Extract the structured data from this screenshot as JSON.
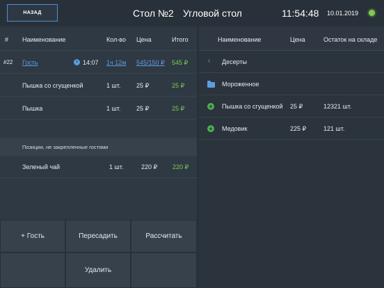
{
  "header": {
    "back_label": "НАЗАД",
    "table_number": "Стол №2",
    "table_name": "Угловой стол",
    "time": "11:54:48",
    "date": "10.01.2019",
    "status_color": "#7ecb52"
  },
  "order": {
    "columns": [
      "#",
      "Наименование",
      "Кол-во",
      "Цена",
      "Итого"
    ],
    "guest_row": {
      "number": "#22",
      "name": "Гость",
      "time": "14:07",
      "duration": "1ч 12м",
      "price": "545/150 ₽",
      "total": "545 ₽"
    },
    "items": [
      {
        "name": "Пышка со сгущенкой",
        "qty": "1 шт.",
        "price": "25 ₽",
        "total": "25 ₽"
      },
      {
        "name": "Пышка",
        "qty": "1 шт.",
        "price": "25 ₽",
        "total": "25 ₽"
      }
    ],
    "unassigned_label": "Позиции, не закрепленные гостями",
    "unassigned_items": [
      {
        "name": "Зеленый чай",
        "qty": "1 шт.",
        "price": "220 ₽",
        "total": "220 ₽"
      }
    ]
  },
  "actions": {
    "add_guest": "+ Гость",
    "move": "Пересадить",
    "checkout": "Рассчитать",
    "delete": "Удалить"
  },
  "menu": {
    "columns": [
      "Наименование",
      "Цена",
      "Остаток на складе"
    ],
    "back_category": "Десерты",
    "folder": "Мороженное",
    "items": [
      {
        "name": "Пышка со сгущенкой",
        "price": "25 ₽",
        "stock": "12321 шт."
      },
      {
        "name": "Медовик",
        "price": "225 ₽",
        "stock": "121 шт."
      }
    ]
  }
}
